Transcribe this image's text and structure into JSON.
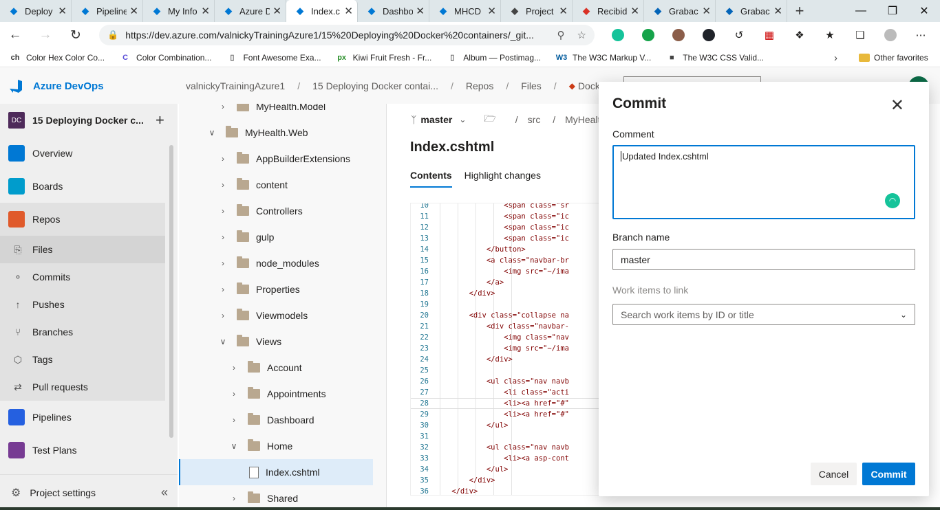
{
  "browser": {
    "tabs": [
      {
        "title": "Deploy",
        "icon": "azure-icon",
        "color": "#0078d4"
      },
      {
        "title": "Pipeline",
        "icon": "devops-icon",
        "color": "#0078d4"
      },
      {
        "title": "My Info",
        "icon": "devops-icon",
        "color": "#0078d4"
      },
      {
        "title": "Azure D",
        "icon": "devops-icon",
        "color": "#0078d4"
      },
      {
        "title": "Index.c",
        "icon": "devops-icon",
        "color": "#0078d4",
        "active": true
      },
      {
        "title": "Dashbo",
        "icon": "devops-icon",
        "color": "#0078d4"
      },
      {
        "title": "MHCD",
        "icon": "devops-icon",
        "color": "#0078d4"
      },
      {
        "title": "Project",
        "icon": "edit-icon",
        "color": "#444444"
      },
      {
        "title": "Recibid",
        "icon": "gmail-icon",
        "color": "#d93025"
      },
      {
        "title": "Grabac",
        "icon": "onedrive-icon",
        "color": "#0364b8"
      },
      {
        "title": "Grabac",
        "icon": "onedrive-icon",
        "color": "#0364b8"
      }
    ],
    "url": "https://dev.azure.com/valnickyTrainingAzure1/15%20Deploying%20Docker%20containers/_git...",
    "favorites": [
      {
        "label": "Color Hex Color Co...",
        "icon": "ch"
      },
      {
        "label": "Color Combination...",
        "icon": "c"
      },
      {
        "label": "Font Awesome Exa...",
        "icon": "page"
      },
      {
        "label": "Kiwi Fruit Fresh - Fr...",
        "icon": "px"
      },
      {
        "label": "Album — Postimag...",
        "icon": "page"
      },
      {
        "label": "The W3C Markup V...",
        "icon": "w3c"
      },
      {
        "label": "The W3C CSS Valid...",
        "icon": "w3c-css"
      }
    ],
    "other_favorites": "Other favorites"
  },
  "ado": {
    "brand": "Azure DevOps",
    "breadcrumb": [
      "valnickyTrainingAzure1",
      "15 Deploying Docker contai...",
      "Repos",
      "Files",
      "Docker"
    ],
    "project_badge": "DC",
    "project_name": "15 Deploying Docker c...",
    "nav": [
      {
        "label": "Overview",
        "icon": "overview-icon",
        "color": "#0078d4"
      },
      {
        "label": "Boards",
        "icon": "boards-icon",
        "color": "#009ccc"
      },
      {
        "label": "Repos",
        "icon": "repos-icon",
        "color": "#e05a2b"
      }
    ],
    "repos_sub": [
      {
        "label": "Files",
        "icon": "files-icon"
      },
      {
        "label": "Commits",
        "icon": "commits-icon"
      },
      {
        "label": "Pushes",
        "icon": "pushes-icon"
      },
      {
        "label": "Branches",
        "icon": "branches-icon"
      },
      {
        "label": "Tags",
        "icon": "tags-icon"
      },
      {
        "label": "Pull requests",
        "icon": "pull-requests-icon"
      }
    ],
    "nav_after": [
      {
        "label": "Pipelines",
        "icon": "pipelines-icon",
        "color": "#2560e0"
      },
      {
        "label": "Test Plans",
        "icon": "test-plans-icon",
        "color": "#773b93"
      }
    ],
    "project_settings": "Project settings"
  },
  "tree": [
    {
      "label": "MyHealth.Model",
      "depth": 1,
      "expanded": false
    },
    {
      "label": "MyHealth.Web",
      "depth": 0,
      "expanded": true
    },
    {
      "label": "AppBuilderExtensions",
      "depth": 1,
      "expanded": false
    },
    {
      "label": "content",
      "depth": 1,
      "expanded": false
    },
    {
      "label": "Controllers",
      "depth": 1,
      "expanded": false
    },
    {
      "label": "gulp",
      "depth": 1,
      "expanded": false
    },
    {
      "label": "node_modules",
      "depth": 1,
      "expanded": false
    },
    {
      "label": "Properties",
      "depth": 1,
      "expanded": false
    },
    {
      "label": "Viewmodels",
      "depth": 1,
      "expanded": false
    },
    {
      "label": "Views",
      "depth": 1,
      "expanded": true
    },
    {
      "label": "Account",
      "depth": 2,
      "expanded": false
    },
    {
      "label": "Appointments",
      "depth": 2,
      "expanded": false
    },
    {
      "label": "Dashboard",
      "depth": 2,
      "expanded": false
    },
    {
      "label": "Home",
      "depth": 2,
      "expanded": true
    },
    {
      "label": "Index.cshtml",
      "depth": 3,
      "file": true,
      "selected": true
    },
    {
      "label": "Shared",
      "depth": 2,
      "expanded": false
    }
  ],
  "main": {
    "branch": "master",
    "path": [
      "src",
      "MyHealt"
    ],
    "file_title": "Index.cshtml",
    "tabs": [
      "Contents",
      "Highlight changes"
    ],
    "code": [
      {
        "n": "10",
        "t": "                <span class=\"sr"
      },
      {
        "n": "11",
        "t": "                <span class=\"ic"
      },
      {
        "n": "12",
        "t": "                <span class=\"ic"
      },
      {
        "n": "13",
        "t": "                <span class=\"ic"
      },
      {
        "n": "14",
        "t": "            </button>"
      },
      {
        "n": "15",
        "t": "            <a class=\"navbar-br"
      },
      {
        "n": "16",
        "t": "                <img src=\"~/ima"
      },
      {
        "n": "17",
        "t": "            </a>"
      },
      {
        "n": "18",
        "t": "        </div>"
      },
      {
        "n": "19",
        "t": ""
      },
      {
        "n": "20",
        "t": "        <div class=\"collapse na"
      },
      {
        "n": "21",
        "t": "            <div class=\"navbar-"
      },
      {
        "n": "22",
        "t": "                <img class=\"nav"
      },
      {
        "n": "23",
        "t": "                <img src=\"~/ima"
      },
      {
        "n": "24",
        "t": "            </div>"
      },
      {
        "n": "25",
        "t": ""
      },
      {
        "n": "26",
        "t": "            <ul class=\"nav navb"
      },
      {
        "n": "27",
        "t": "                <li class=\"acti"
      },
      {
        "n": "28",
        "t": "                <li><a href=\"#\""
      },
      {
        "n": "29",
        "t": "                <li><a href=\"#\""
      },
      {
        "n": "30",
        "t": "            </ul>"
      },
      {
        "n": "31",
        "t": ""
      },
      {
        "n": "32",
        "t": "            <ul class=\"nav navb"
      },
      {
        "n": "33",
        "t": "                <li><a asp-cont"
      },
      {
        "n": "34",
        "t": "            </ul>"
      },
      {
        "n": "35",
        "t": "        </div>"
      },
      {
        "n": "36",
        "t": "    </div>"
      }
    ]
  },
  "commit_panel": {
    "title": "Commit",
    "comment_label": "Comment",
    "comment_value": "Updated Index.cshtml",
    "branch_label": "Branch name",
    "branch_value": "master",
    "work_items_label": "Work items to link",
    "work_items_placeholder": "Search work items by ID or title",
    "cancel": "Cancel",
    "commit": "Commit"
  }
}
